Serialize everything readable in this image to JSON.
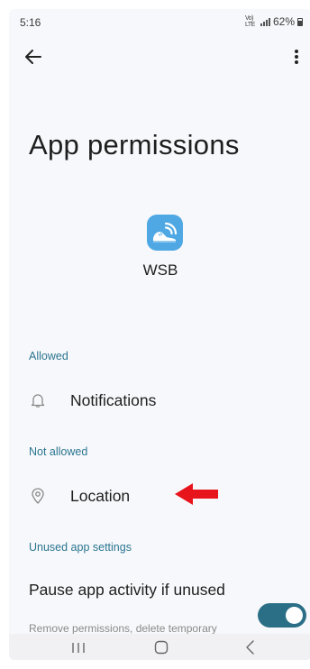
{
  "status_bar": {
    "time": "5:16",
    "volte": "Vo) LTE",
    "battery": "62%"
  },
  "header": {
    "back_icon": "arrow-left-icon",
    "more_icon": "more-vert-icon"
  },
  "page": {
    "title": "App permissions",
    "app_name": "WSB",
    "app_icon": "shoe-wifi-icon",
    "app_icon_color": "#4fa8e3"
  },
  "sections": {
    "allowed_header": "Allowed",
    "allowed_items": [
      {
        "label": "Notifications",
        "icon": "bell-icon"
      }
    ],
    "not_allowed_header": "Not allowed",
    "not_allowed_items": [
      {
        "label": "Location",
        "icon": "location-pin-icon"
      }
    ],
    "unused_header": "Unused app settings"
  },
  "unused_settings": {
    "pause_title": "Pause app activity if unused",
    "pause_subtitle": "Remove permissions, delete temporary",
    "pause_enabled": true,
    "toggle_color": "#2b6f87"
  },
  "annotation": {
    "arrow_color": "#e8141b"
  },
  "nav_bar": {
    "recents_icon": "recents-icon",
    "home_icon": "home-icon",
    "back_icon": "nav-back-icon"
  },
  "colors": {
    "section_header": "#2a7590",
    "background": "#f7f8fb"
  }
}
